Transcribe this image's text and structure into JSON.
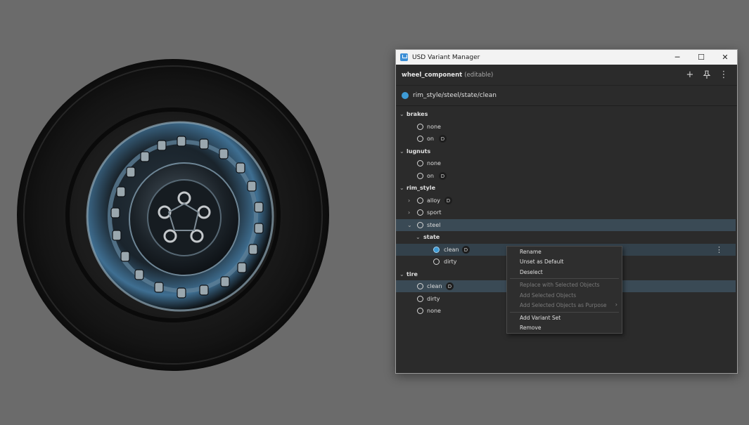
{
  "window": {
    "title": "USD Variant Manager"
  },
  "window_buttons": {
    "minimize": "─",
    "maximize": "☐",
    "close": "✕"
  },
  "toolbar": {
    "name": "wheel_component",
    "editable": "(editable)",
    "add_glyph": "+",
    "menu_glyph": "⋮"
  },
  "path": {
    "text": "rim_style/steel/state/clean"
  },
  "tree": {
    "brakes": {
      "label": "brakes",
      "none": "none",
      "on": "on",
      "on_badge": "D"
    },
    "lugnuts": {
      "label": "lugnuts",
      "none": "none",
      "on": "on",
      "on_badge": "D"
    },
    "rim_style": {
      "label": "rim_style",
      "alloy": "alloy",
      "alloy_badge": "D",
      "sport": "sport",
      "steel": "steel",
      "state": {
        "label": "state",
        "clean": "clean",
        "clean_badge": "D",
        "dirty": "dirty"
      }
    },
    "tire": {
      "label": "tire",
      "clean": "clean",
      "clean_badge": "D",
      "dirty": "dirty",
      "none": "none"
    }
  },
  "row_menu_glyph": "⋮",
  "context_menu": {
    "rename": "Rename",
    "unset_default": "Unset as Default",
    "deselect": "Deselect",
    "replace_selected": "Replace with Selected Objects",
    "add_selected": "Add Selected Objects",
    "add_selected_purpose": "Add Selected Objects as Purpose",
    "add_variant_set": "Add Variant Set",
    "remove": "Remove"
  },
  "colors": {
    "accent": "#3e9bd6",
    "panel_bg": "#2b2b2b",
    "selected_row": "#3a4a55",
    "viewport_bg": "#6b6b6b"
  }
}
